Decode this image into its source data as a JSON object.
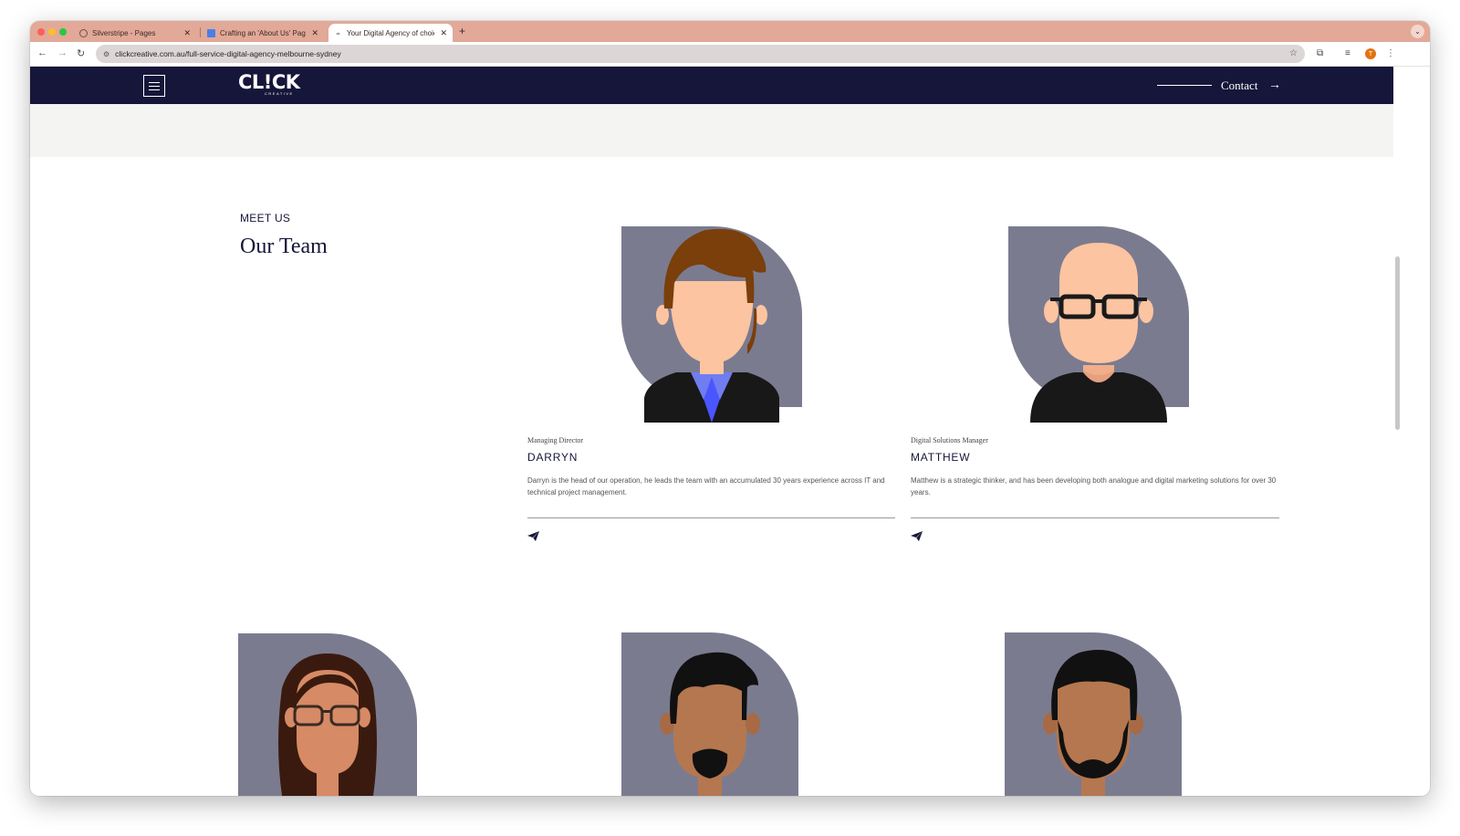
{
  "browser": {
    "tabs": [
      {
        "title": "Silverstripe - Pages",
        "active": false,
        "icon": "globe-icon"
      },
      {
        "title": "Crafting an 'About Us' Page T",
        "active": false,
        "icon": "docs-icon"
      },
      {
        "title": "Your Digital Agency of choice",
        "active": true,
        "icon": "click-creative-icon"
      }
    ],
    "url": "clickcreative.com.au/full-service-digital-agency-melbourne-sydney",
    "profile_initial": "T",
    "accent_color": "#e2a898"
  },
  "site": {
    "logo": "CL!CK",
    "logo_sub": "CREATIVE",
    "contact_label": "Contact",
    "header_color": "#16163a"
  },
  "section": {
    "eyebrow": "MEET US",
    "title": "Our Team"
  },
  "team": [
    {
      "role": "Managing Director",
      "name": "DARRYN",
      "bio": "Darryn is the head of our operation, he leads the team with an accumulated 30 years experience across IT and technical project management."
    },
    {
      "role": "Digital Solutions Manager",
      "name": "MATTHEW",
      "bio": "Matthew is a strategic thinker, and has been developing both analogue and digital marketing solutions for over 30 years."
    }
  ]
}
